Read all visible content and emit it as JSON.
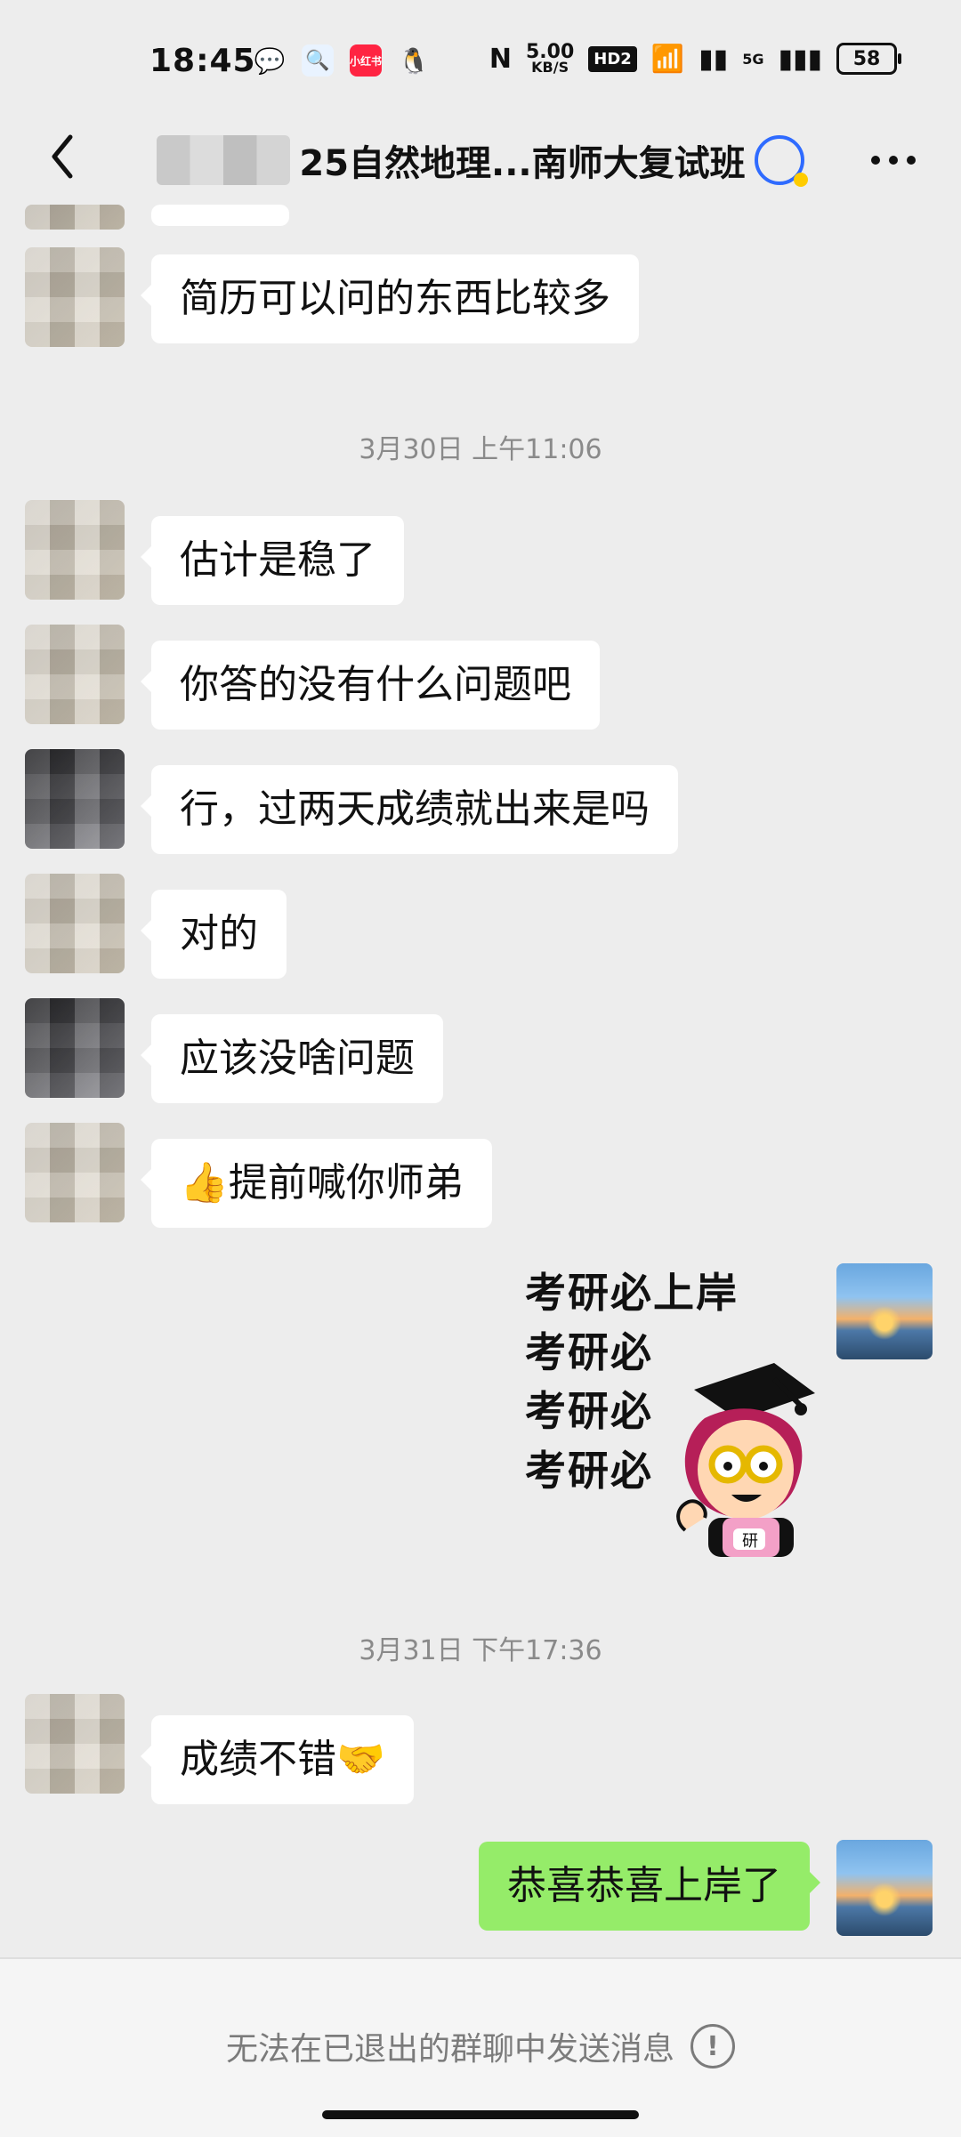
{
  "status_bar": {
    "time": "18:45",
    "apps": {
      "wechat": "💬",
      "search": "🔍",
      "xhs": "小红书",
      "qq": "🐧"
    },
    "nfc": "N",
    "speed_value": "5.00",
    "speed_unit": "KB/S",
    "hd": "HD2",
    "wifi": "📶",
    "signal1": "▮▮",
    "fiveg": "5G",
    "signal2": "▮▮▮",
    "battery": "58"
  },
  "header": {
    "title": "25自然地理...南师大复试班",
    "back_icon": "back-icon",
    "more_icon": "more-icon"
  },
  "messages": {
    "m1": "简历可以问的东西比较多",
    "t1": "3月30日 上午11:06",
    "m2": "估计是稳了",
    "m3": "你答的没有什么问题吧",
    "m4": "行，过两天成绩就出来是吗",
    "m5": "对的",
    "m6": "应该没啥问题",
    "m7_prefix": "👍",
    "m7_text": "提前喊你师弟",
    "t2": "3月31日 下午17:36",
    "m8_text": "成绩不错",
    "m8_suffix": "🤝",
    "m9": "恭喜恭喜上岸了"
  },
  "sticker": {
    "lines": [
      "考研必上岸",
      "考研必",
      "考研必",
      "考研必"
    ],
    "badge": "研"
  },
  "bottom": {
    "notice": "无法在已退出的群聊中发送消息",
    "info_icon": "!"
  }
}
